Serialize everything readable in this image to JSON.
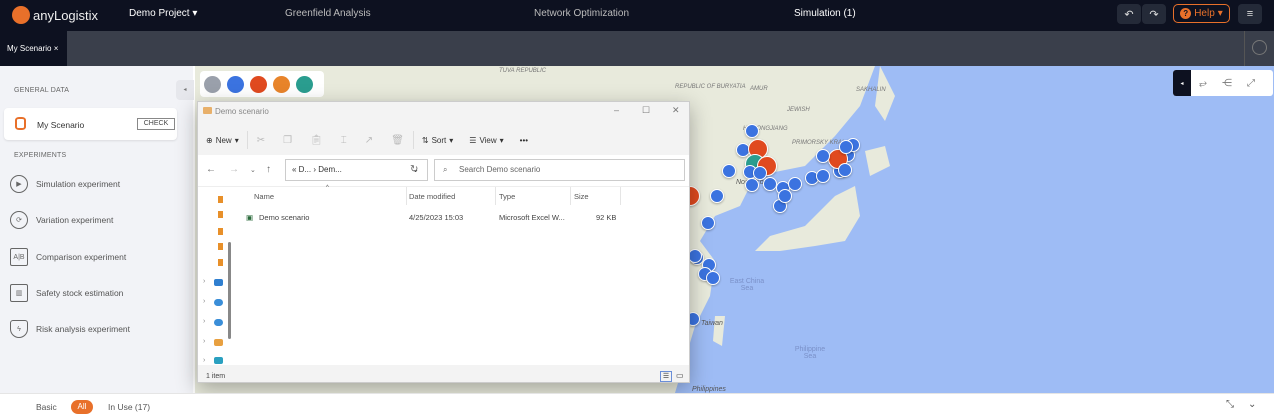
{
  "header": {
    "logo": "anyLogistix",
    "project": "Demo Project",
    "nav": [
      "Greenfield Analysis",
      "Network Optimization",
      "Simulation (1)"
    ],
    "help": "Help"
  },
  "tabs": {
    "active": "My Scenario"
  },
  "sidebar": {
    "general_title": "GENERAL DATA",
    "scenario": "My Scenario",
    "check": "CHECK",
    "experiments_title": "EXPERIMENTS",
    "experiments": [
      {
        "label": "Simulation experiment",
        "icon": "play-icon"
      },
      {
        "label": "Variation experiment",
        "icon": "cycle-icon"
      },
      {
        "label": "Comparison experiment",
        "icon": "ab-compare-icon"
      },
      {
        "label": "Safety stock estimation",
        "icon": "stock-icon"
      },
      {
        "label": "Risk analysis experiment",
        "icon": "shield-icon"
      }
    ]
  },
  "map": {
    "labels": [
      "TUVA REPUBLIC",
      "REPUBLIC OF BURYATIA",
      "AMUR",
      "JEWISH",
      "SAKHALIN",
      "HEILONGJIANG",
      "PRIMORSKY KRAI",
      "North Korea",
      "Taiwan",
      "Philippines"
    ],
    "ocean_labels": [
      "Sea of Japan",
      "East China Sea",
      "Philippine Sea"
    ],
    "colors": {
      "customer": "#3b73e0",
      "warehouse": "#e04a1f",
      "dc": "#2a9d8f",
      "ocean": "#9ebcf5",
      "land": "#e8eadc"
    }
  },
  "explorer": {
    "title": "Demo scenario",
    "ribbon": {
      "new": "New",
      "sort": "Sort",
      "view": "View",
      "more": "•••"
    },
    "path": [
      "D...",
      "Dem..."
    ],
    "search_placeholder": "Search Demo scenario",
    "columns": [
      "Name",
      "Date modified",
      "Type",
      "Size"
    ],
    "files": [
      {
        "name": "Demo scenario",
        "date": "4/25/2023 15:03",
        "type": "Microsoft Excel W...",
        "size": "92 KB"
      }
    ],
    "status": "1 item"
  },
  "footer": {
    "basic": "Basic",
    "all": "All",
    "in_use": "In Use (17)"
  }
}
